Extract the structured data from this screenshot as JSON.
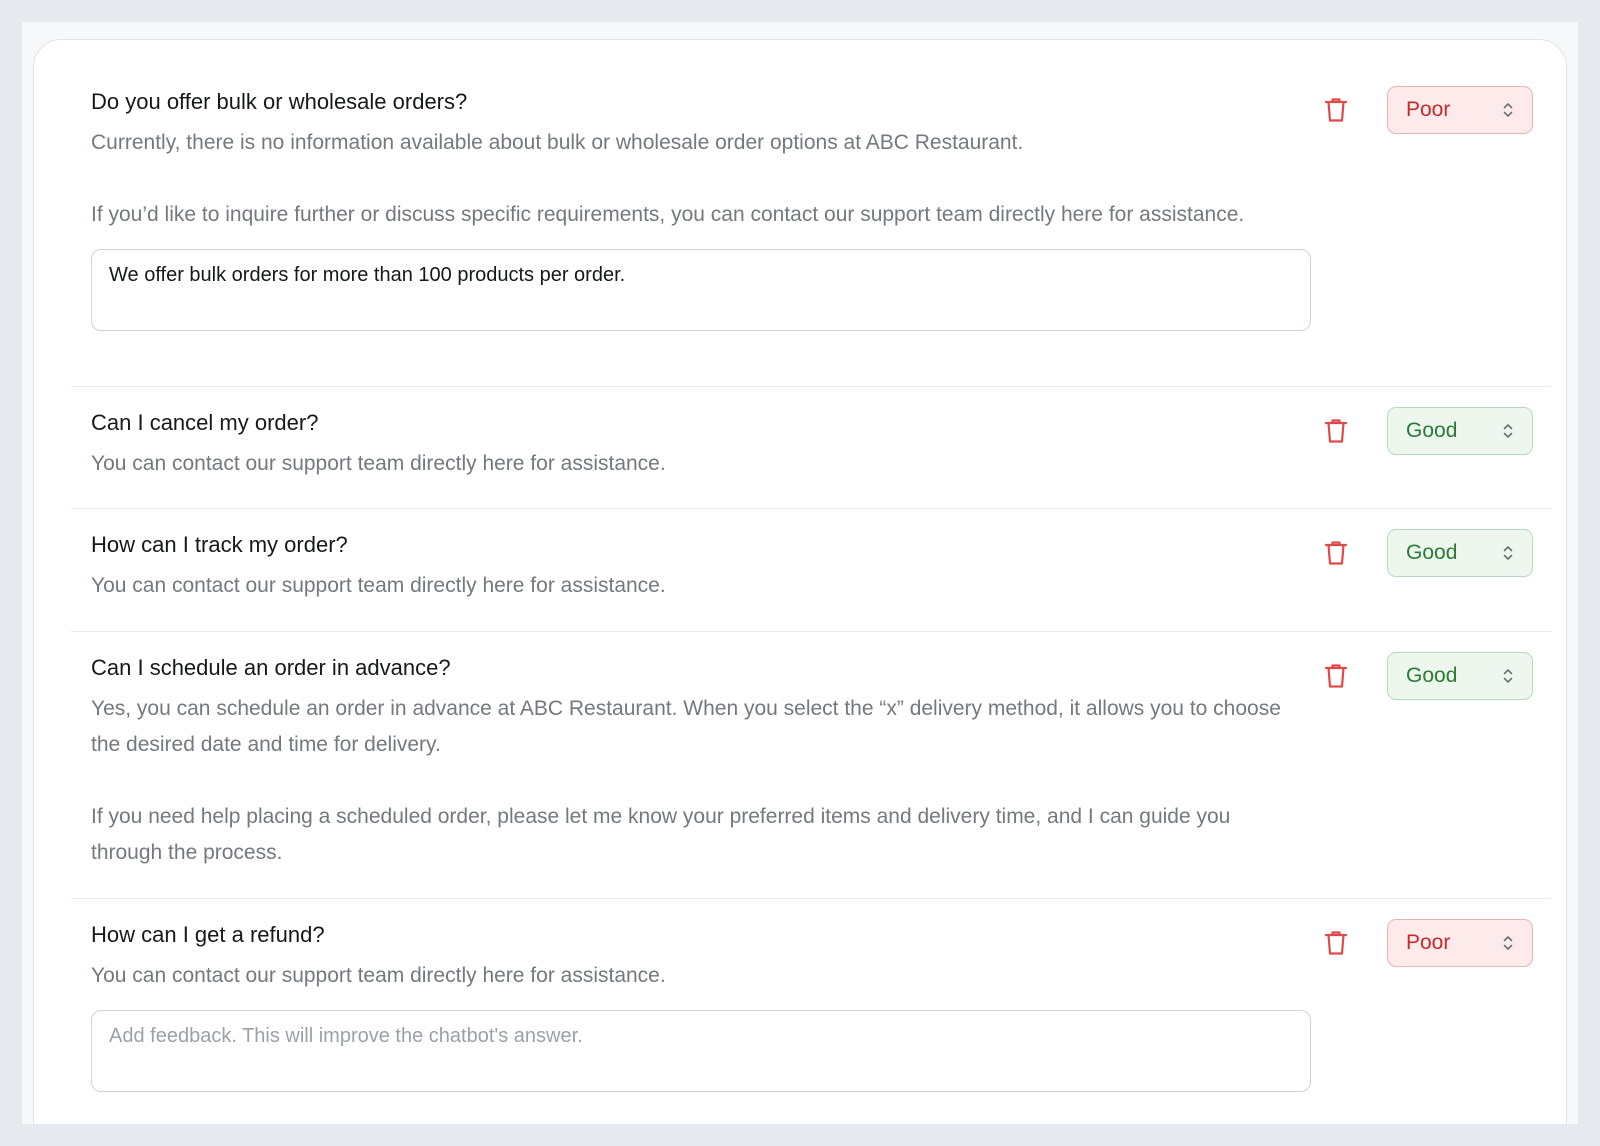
{
  "icons": {
    "delete": "trash-icon",
    "rating_toggle": "chevron-up-down-icon"
  },
  "colors": {
    "poor_text": "#c42b2b",
    "poor_bg": "#fdeaea",
    "good_text": "#2b7a35",
    "good_bg": "#edf7ee",
    "trash": "#e0494b"
  },
  "items": [
    {
      "question": "Do you offer bulk or wholesale orders?",
      "answer": [
        "Currently, there is no information available about bulk or wholesale order options at ABC Restaurant.",
        "If you’d like to inquire further or discuss specific requirements, you can contact our support team directly here for assistance."
      ],
      "rating": "Poor",
      "feedback_value": "We offer bulk orders for more than 100 products per order.",
      "feedback_placeholder": "Add feedback. This will improve the chatbot's answer."
    },
    {
      "question": "Can I cancel my order?",
      "answer": [
        "You can contact our support team directly here for assistance."
      ],
      "rating": "Good"
    },
    {
      "question": "How can I track my order?",
      "answer": [
        "You can contact our support team directly here for assistance."
      ],
      "rating": "Good"
    },
    {
      "question": "Can I schedule an order in advance?",
      "answer": [
        "Yes, you can schedule an order in advance at ABC Restaurant. When you select the “x” delivery method, it allows you to choose the desired date and time for delivery.",
        "If you need help placing a scheduled order, please let me know your preferred items and delivery time, and I can guide you through the process."
      ],
      "rating": "Good"
    },
    {
      "question": "How can I get a refund?",
      "answer": [
        "You can contact our support team directly here for assistance."
      ],
      "rating": "Poor",
      "feedback_value": "",
      "feedback_placeholder": "Add feedback. This will improve the chatbot's answer."
    }
  ]
}
